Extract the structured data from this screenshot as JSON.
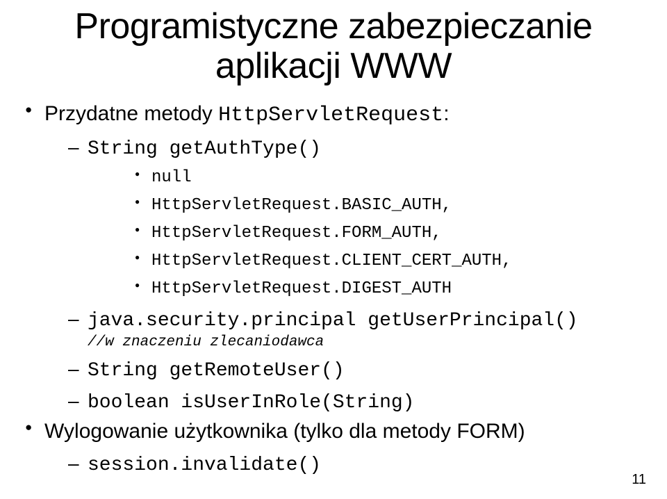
{
  "title_line1": "Programistyczne zabezpieczanie",
  "title_line2": "aplikacji WWW",
  "bullets": {
    "b1": {
      "prefix": "Przydatne metody ",
      "code": "HttpServletRequest",
      "suffix": ":"
    },
    "b1_1": {
      "code": "String getAuthType()"
    },
    "b1_1_1": {
      "code": "null"
    },
    "b1_1_2": {
      "code": "HttpServletRequest.BASIC_AUTH,"
    },
    "b1_1_3": {
      "code": "HttpServletRequest.FORM_AUTH,"
    },
    "b1_1_4": {
      "code": "HttpServletRequest.CLIENT_CERT_AUTH,"
    },
    "b1_1_5": {
      "code": "HttpServletRequest.DIGEST_AUTH"
    },
    "b1_2": {
      "code": "java.security.principal getUserPrincipal()",
      "comment": "//w znaczeniu zlecaniodawca"
    },
    "b1_3": {
      "code": "String getRemoteUser()"
    },
    "b1_4": {
      "code": "boolean isUserInRole(String)"
    },
    "b2": {
      "text": "Wylogowanie użytkownika (tylko dla metody FORM)"
    },
    "b2_1": {
      "code": "session.invalidate()"
    }
  },
  "page_number": "11"
}
